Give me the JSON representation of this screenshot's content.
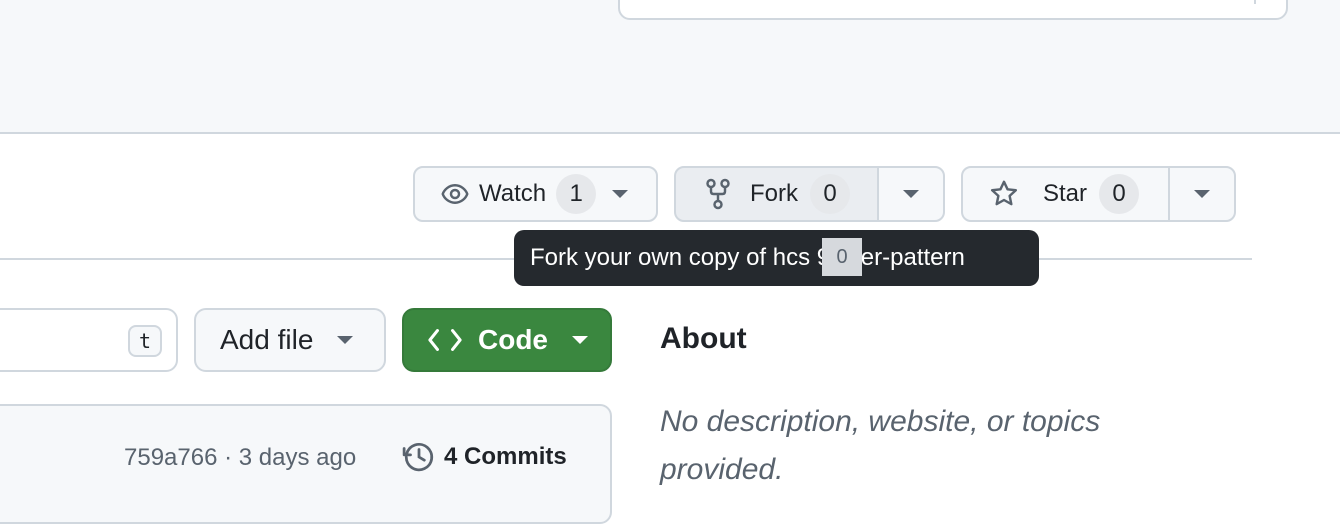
{
  "repo_actions": {
    "watch": {
      "label": "Watch",
      "count": "1"
    },
    "fork": {
      "label": "Fork",
      "count": "0"
    },
    "star": {
      "label": "Star",
      "count": "0"
    }
  },
  "tooltip": {
    "text": "Fork your own copy of hcs  9/filter-pattern",
    "overlay_count": "0"
  },
  "file_toolbar": {
    "shortcut_key": "t",
    "add_file_label": "Add file",
    "code_label": "Code"
  },
  "about": {
    "title": "About",
    "description": "No description, website, or topics provided."
  },
  "latest_commit": {
    "meta": "759a766 · 3 days ago",
    "commits_label": "4 Commits"
  },
  "colors": {
    "header_bg": "#f6f8fa",
    "border": "#d0d7de",
    "code_button": "#3a873f",
    "tooltip_bg": "#25292e",
    "muted_text": "#59636e"
  },
  "icons": [
    "eye-icon",
    "repo-forked-icon",
    "star-icon",
    "code-icon",
    "history-icon",
    "triangle-down-icon",
    "chevron-down-icon"
  ]
}
